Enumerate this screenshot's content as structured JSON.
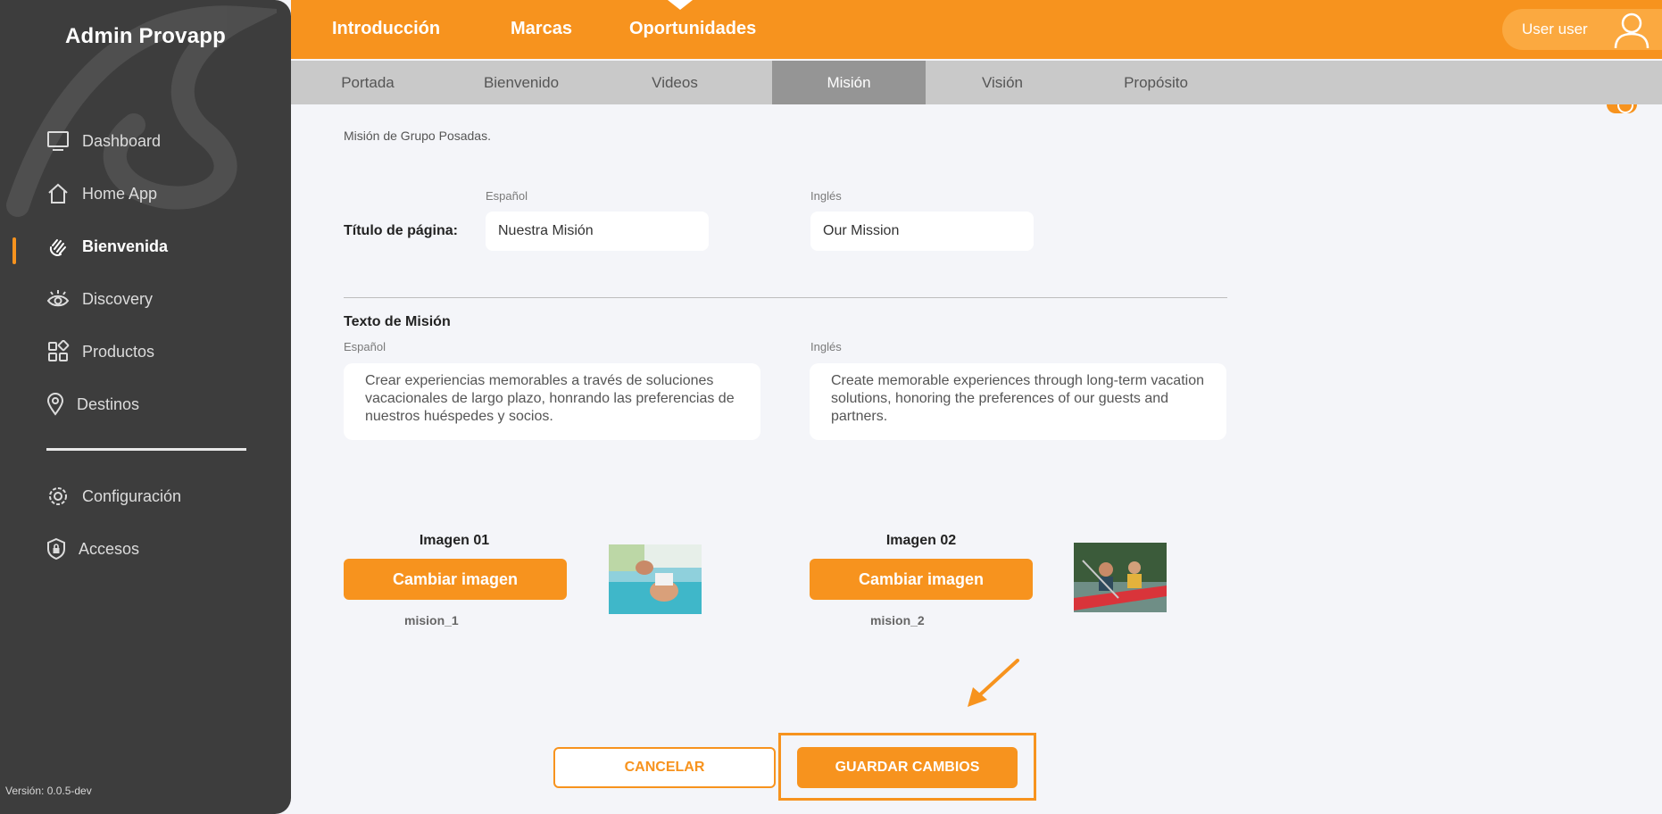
{
  "sidebar": {
    "brand": "Admin Provapp",
    "items": [
      {
        "label": "Dashboard",
        "icon": "monitor-icon"
      },
      {
        "label": "Home App",
        "icon": "home-icon"
      },
      {
        "label": "Bienvenida",
        "icon": "waving-hand-icon",
        "active": true
      },
      {
        "label": "Discovery",
        "icon": "eye-icon"
      },
      {
        "label": "Productos",
        "icon": "grid-icon"
      },
      {
        "label": "Destinos",
        "icon": "location-pin-icon"
      }
    ],
    "secondary": [
      {
        "label": "Configuración",
        "icon": "gear-icon"
      },
      {
        "label": "Accesos",
        "icon": "shield-lock-icon"
      }
    ],
    "version": "Versión: 0.0.5-dev"
  },
  "header": {
    "tabs": [
      {
        "label": "Introducción",
        "active": true
      },
      {
        "label": "Marcas"
      },
      {
        "label": "Oportunidades"
      }
    ],
    "user": "User user"
  },
  "subtabs": [
    {
      "label": "Portada"
    },
    {
      "label": "Bienvenido"
    },
    {
      "label": "Videos"
    },
    {
      "label": "Misión",
      "active": true
    },
    {
      "label": "Visión"
    },
    {
      "label": "Propósito"
    }
  ],
  "page": {
    "description": "Misión de Grupo Posadas.",
    "title_label": "Título de página:",
    "lang_es": "Español",
    "lang_en": "Inglés",
    "title_es": "Nuestra Misión",
    "title_en": "Our Mission",
    "text_section": "Texto de Misión",
    "text_es": "Crear experiencias memorables a través de soluciones vacacionales de largo plazo, honrando las preferencias de nuestros huéspedes y socios.",
    "text_en": "Create memorable experiences through long-term vacation solutions, honoring the preferences of our guests and partners.",
    "images": [
      {
        "title": "Imagen 01",
        "button": "Cambiar imagen",
        "file": "mision_1"
      },
      {
        "title": "Imagen 02",
        "button": "Cambiar imagen",
        "file": "mision_2"
      }
    ]
  },
  "actions": {
    "cancel": "CANCELAR",
    "save": "GUARDAR CAMBIOS"
  },
  "colors": {
    "accent": "#f7931e",
    "sidebar_bg": "#3d3d3d",
    "subtab_active": "#959595"
  }
}
